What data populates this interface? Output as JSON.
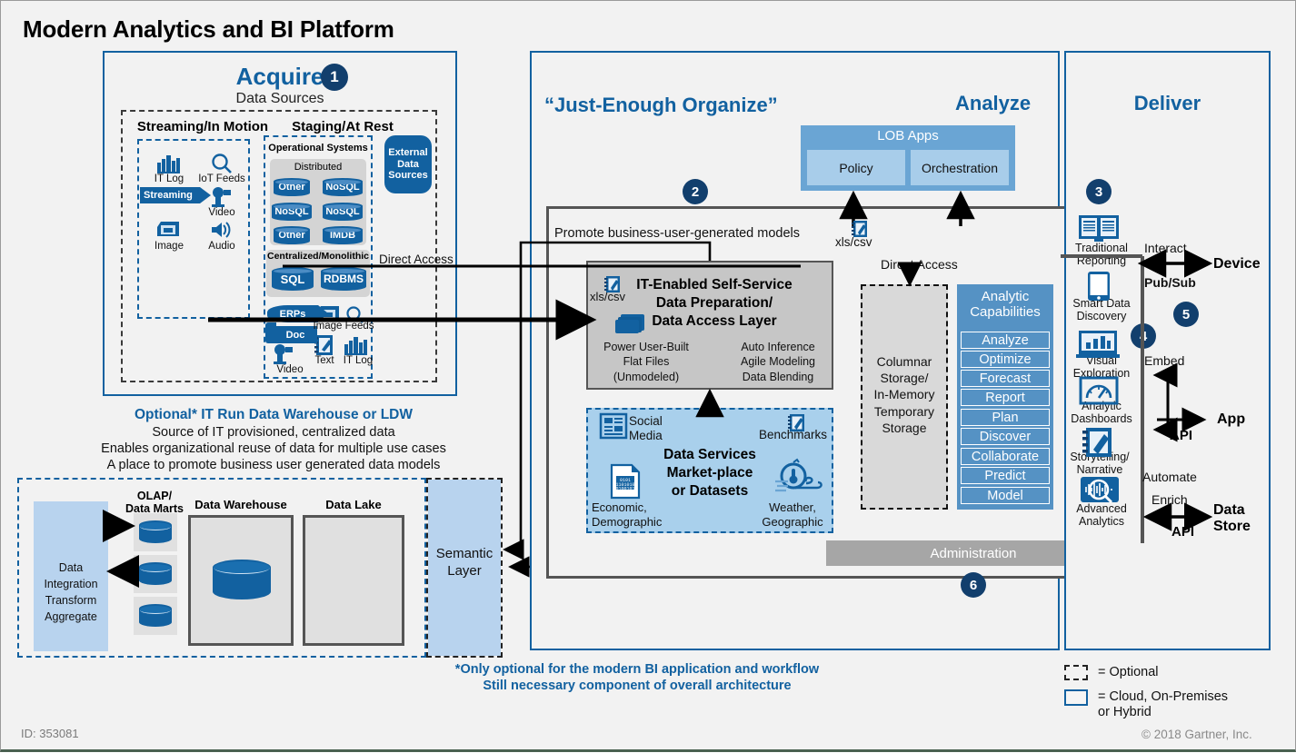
{
  "title": "Modern Analytics and BI Platform",
  "acquire": {
    "heading": "Acquire",
    "badge": "1",
    "subtitle": "Data Sources",
    "streaming_label": "Streaming/In Motion",
    "staging_label": "Staging/At Rest",
    "operational_systems": "Operational Systems",
    "distributed": "Distributed",
    "centralized": "Centralized/Monolithic",
    "distributed_stores": [
      "Other",
      "NoSQL",
      "NoSQL",
      "NoSQL",
      "Other",
      "IMDB"
    ],
    "centralized_stores": [
      "SQL",
      "RDBMS"
    ],
    "streaming_icons": [
      {
        "name": "IT Log",
        "icon": "it-log-icon"
      },
      {
        "name": "IoT Feeds",
        "icon": "iot-feeds-icon"
      },
      {
        "name": "Video",
        "icon": "video-icon"
      },
      {
        "name": "Image",
        "icon": "image-icon"
      },
      {
        "name": "Audio",
        "icon": "audio-icon"
      }
    ],
    "streaming_tag": "Streaming",
    "staging_icons": [
      {
        "name": "ERPs",
        "icon": "erps-icon"
      },
      {
        "name": "Doc",
        "icon": "doc-icon"
      },
      {
        "name": "Image Feeds",
        "icon": "image-feeds-icon"
      },
      {
        "name": "Video",
        "icon": "video-icon"
      },
      {
        "name": "Text",
        "icon": "text-icon"
      },
      {
        "name": "IT Log",
        "icon": "it-log-icon"
      }
    ],
    "external_data_sources": "External Data Sources",
    "direct_access": "Direct Access"
  },
  "ldw": {
    "heading": "Optional* IT Run Data Warehouse or LDW",
    "line1": "Source of IT provisioned, centralized data",
    "line2": "Enables organizational reuse of data for multiple use cases",
    "line3": "A place to promote business user generated data models",
    "data_integration": "Data\nIntegration\nTransform\nAggregate",
    "olap_label": "OLAP/\nData Marts",
    "data_warehouse_label": "Data Warehouse",
    "data_lake_label": "Data Lake",
    "semantic_layer": "Semantic\nLayer"
  },
  "organize": {
    "heading": "“Just-Enough Organize”",
    "badge": "2",
    "promote_label": "Promote business-user-generated models",
    "xls_csv": "xls/csv",
    "direct_access": "Direct Access",
    "prep_title": "IT-Enabled Self-Service\nData Preparation/\nData Access Layer",
    "prep_left": "Power User-Built\nFlat Files\n(Unmodeled)",
    "prep_right": "Auto Inference\nAgile Modeling\nData Blending",
    "data_services_title": "Data Services\nMarket-place\nor Datasets",
    "ds_social": "Social\nMedia",
    "ds_benchmarks": "Benchmarks",
    "ds_economic": "Economic,\nDemographic",
    "ds_weather": "Weather,\nGeographic",
    "columnar_storage": "Columnar\nStorage/\nIn-Memory\nTemporary\nStorage",
    "administration": "Administration",
    "admin_badge": "6"
  },
  "analyze": {
    "heading": "Analyze",
    "lob_apps": "LOB Apps",
    "lob_children": [
      "Policy",
      "Orchestration"
    ],
    "analytic_capabilities_title": "Analytic\nCapabilities",
    "analytic_capabilities": [
      "Analyze",
      "Optimize",
      "Forecast",
      "Report",
      "Plan",
      "Discover",
      "Collaborate",
      "Predict",
      "Model"
    ]
  },
  "deliver": {
    "heading": "Deliver",
    "badge3": "3",
    "badge4": "4",
    "badge5": "5",
    "items": [
      {
        "label": "Traditional\nReporting",
        "icon": "traditional-reporting-icon"
      },
      {
        "label": "Smart Data\nDiscovery",
        "icon": "smart-data-discovery-icon"
      },
      {
        "label": "Visual\nExploration",
        "icon": "visual-exploration-icon"
      },
      {
        "label": "Analytic\nDashboards",
        "icon": "analytic-dashboards-icon"
      },
      {
        "label": "Storytelling/\nNarrative",
        "icon": "storytelling-icon"
      },
      {
        "label": "Advanced\nAnalytics",
        "icon": "advanced-analytics-icon"
      }
    ],
    "interact": "Interact",
    "pub_sub": "Pub/Sub",
    "device": "Device",
    "embed": "Embed",
    "api1": "API",
    "app": "App",
    "automate": "Automate",
    "enrich": "Enrich",
    "api2": "API",
    "data_store": "Data\nStore"
  },
  "footer": {
    "note1": "*Only optional for the modern BI application and workflow",
    "note2": "Still necessary component of overall architecture",
    "id": "ID: 353081",
    "copyright": "© 2018 Gartner, Inc.",
    "legend_optional": "= Optional",
    "legend_cloud": "= Cloud, On-Premises\nor Hybrid"
  },
  "colors": {
    "brand_blue": "#1261a0",
    "dark_navy": "#123f6d",
    "light_blue": "#a9d0ec",
    "mid_blue": "#5592c4"
  }
}
